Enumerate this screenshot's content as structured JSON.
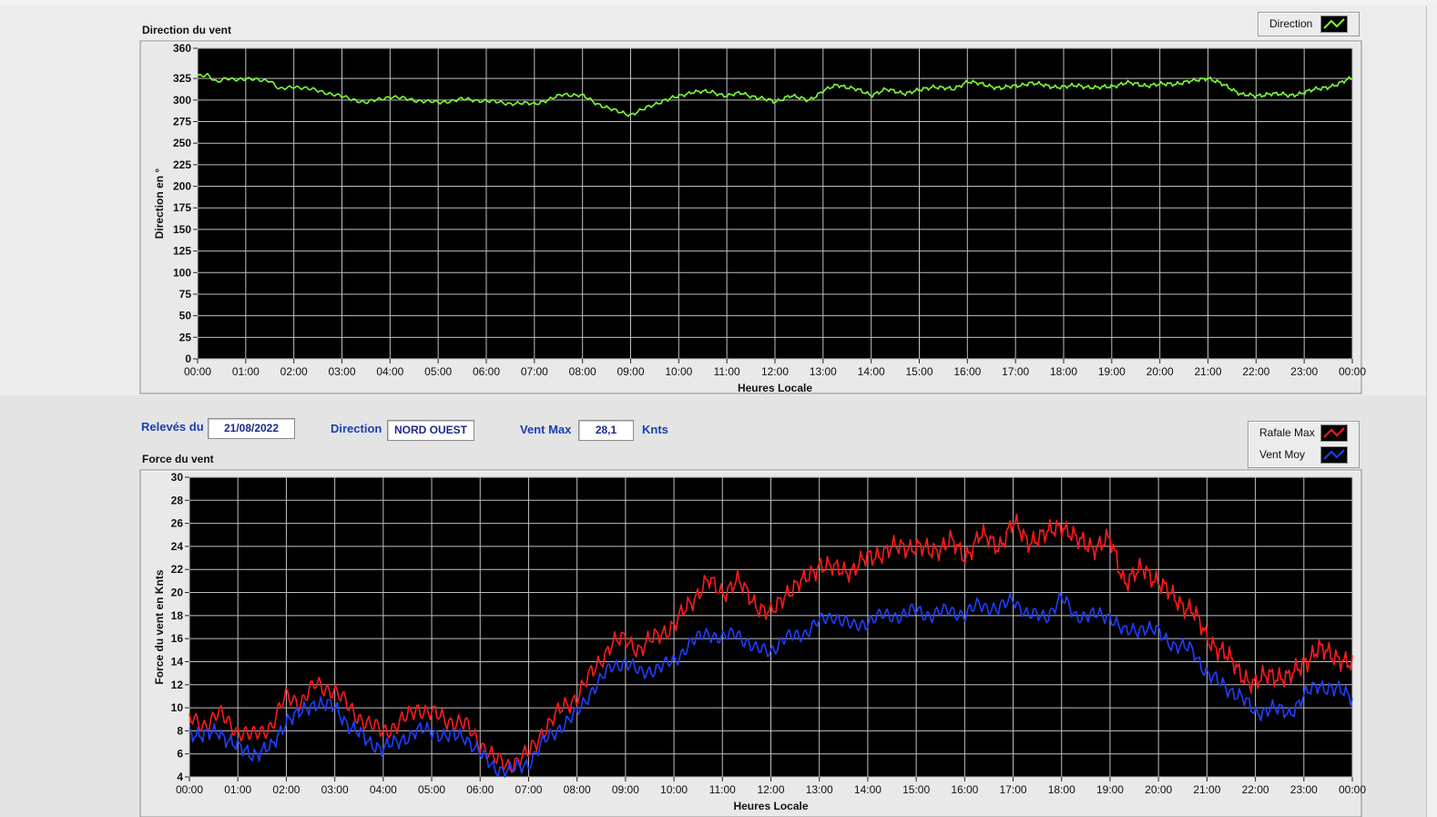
{
  "info": {
    "releves_label": "Relevés du",
    "releves_value": "21/08/2022",
    "direction_label": "Direction",
    "direction_value": "NORD OUEST",
    "ventmax_label": "Vent Max",
    "ventmax_value": "28,1",
    "ventmax_unit": "Knts"
  },
  "colors": {
    "plot_bg": "#000000",
    "grid": "#bfbfbf",
    "direction": "#7CFC3A",
    "rafale": "#ff1a1a",
    "vent_moy": "#1f3fff"
  },
  "chart_data": [
    {
      "type": "line",
      "title": "Direction du vent",
      "xlabel": "Heures Locale",
      "ylabel": "Direction en °",
      "ylim": [
        0,
        360
      ],
      "xlim": [
        0,
        24
      ],
      "yticks": [
        "0",
        "25",
        "50",
        "75",
        "100",
        "125",
        "150",
        "175",
        "200",
        "225",
        "250",
        "275",
        "300",
        "325",
        "360"
      ],
      "xticks": [
        "00:00",
        "01:00",
        "02:00",
        "03:00",
        "04:00",
        "05:00",
        "06:00",
        "07:00",
        "08:00",
        "09:00",
        "10:00",
        "11:00",
        "12:00",
        "13:00",
        "14:00",
        "15:00",
        "16:00",
        "17:00",
        "18:00",
        "19:00",
        "20:00",
        "21:00",
        "22:00",
        "23:00",
        "00:00"
      ],
      "grid": true,
      "legend_position": "top-right",
      "series": [
        {
          "name": "Direction",
          "color": "#7CFC3A",
          "noise": 3,
          "x": [
            0,
            0.2,
            0.4,
            0.6,
            1,
            1.5,
            1.7,
            2,
            2.5,
            3,
            3.5,
            4,
            4.5,
            5,
            5.5,
            6,
            6.5,
            7,
            7.3,
            7.6,
            8,
            8.3,
            8.7,
            9,
            9.3,
            9.7,
            10,
            10.3,
            10.7,
            11,
            11.3,
            11.7,
            12,
            12.3,
            12.7,
            13,
            13.3,
            13.7,
            14,
            14.3,
            14.7,
            15,
            15.3,
            15.7,
            16,
            16.3,
            16.7,
            17,
            17.3,
            17.7,
            18,
            18.3,
            18.7,
            19,
            19.3,
            19.7,
            20,
            20.3,
            20.7,
            21,
            21.3,
            21.7,
            22,
            22.3,
            22.7,
            23,
            23.3,
            23.7,
            24
          ],
          "values": [
            328,
            330,
            320,
            325,
            324,
            323,
            312,
            316,
            311,
            304,
            297,
            304,
            300,
            297,
            301,
            299,
            296,
            296,
            300,
            307,
            305,
            296,
            287,
            283,
            290,
            300,
            304,
            310,
            309,
            305,
            308,
            302,
            298,
            305,
            300,
            310,
            318,
            312,
            306,
            312,
            308,
            311,
            316,
            312,
            322,
            318,
            314,
            316,
            320,
            316,
            315,
            317,
            314,
            316,
            320,
            317,
            318,
            319,
            322,
            326,
            318,
            307,
            304,
            308,
            305,
            309,
            313,
            318,
            326
          ]
        }
      ]
    },
    {
      "type": "line",
      "title": "Force du vent",
      "xlabel": "Heures Locale",
      "ylabel": "Force du vent en Knts",
      "ylim": [
        4,
        30
      ],
      "xlim": [
        0,
        24
      ],
      "yticks": [
        "4",
        "6",
        "8",
        "10",
        "12",
        "14",
        "16",
        "18",
        "20",
        "22",
        "24",
        "26",
        "28",
        "30"
      ],
      "xticks": [
        "00:00",
        "01:00",
        "02:00",
        "03:00",
        "04:00",
        "05:00",
        "06:00",
        "07:00",
        "08:00",
        "09:00",
        "10:00",
        "11:00",
        "12:00",
        "13:00",
        "14:00",
        "15:00",
        "16:00",
        "17:00",
        "18:00",
        "19:00",
        "20:00",
        "21:00",
        "22:00",
        "23:00",
        "00:00"
      ],
      "grid": true,
      "legend_position": "top-right",
      "series": [
        {
          "name": "Rafale Max",
          "color": "#ff1a1a",
          "noise": 1.1,
          "x": [
            0,
            0.3,
            0.6,
            1,
            1.3,
            1.7,
            2,
            2.3,
            2.6,
            3,
            3.3,
            3.7,
            4,
            4.3,
            4.7,
            5,
            5.3,
            5.7,
            6,
            6.3,
            6.6,
            7,
            7.3,
            7.7,
            8,
            8.3,
            8.7,
            9,
            9.3,
            9.7,
            10,
            10.3,
            10.7,
            11,
            11.3,
            11.7,
            12,
            12.3,
            12.7,
            13,
            13.3,
            13.7,
            14,
            14.3,
            14.7,
            15,
            15.3,
            15.7,
            16,
            16.3,
            16.7,
            17,
            17.3,
            17.7,
            18,
            18.3,
            18.7,
            19,
            19.3,
            19.7,
            20,
            20.3,
            20.7,
            21,
            21.3,
            21.7,
            22,
            22.3,
            22.7,
            23,
            23.3,
            23.7,
            24
          ],
          "values": [
            9,
            8.5,
            9.5,
            8,
            7.5,
            8.5,
            11,
            10.5,
            12,
            11.5,
            10,
            8.5,
            8,
            8.5,
            10,
            9.5,
            9,
            8.5,
            7,
            5.5,
            5,
            6,
            8,
            10,
            11,
            13,
            15.5,
            16,
            15,
            16.5,
            17,
            19,
            21,
            20,
            21,
            19,
            18,
            20,
            21,
            22.5,
            22,
            22,
            23,
            23.5,
            24,
            24,
            23.5,
            24.5,
            23,
            25,
            24,
            26,
            24.5,
            25,
            26,
            24.5,
            24,
            24.5,
            21,
            22,
            21,
            19.5,
            18.5,
            16,
            15,
            13,
            12,
            13,
            12.5,
            14,
            15,
            14.5,
            13.5
          ]
        },
        {
          "name": "Vent Moy",
          "color": "#1f3fff",
          "noise": 0.9,
          "x": [
            0,
            0.3,
            0.6,
            1,
            1.3,
            1.7,
            2,
            2.3,
            2.6,
            3,
            3.3,
            3.7,
            4,
            4.3,
            4.7,
            5,
            5.3,
            5.7,
            6,
            6.3,
            6.6,
            7,
            7.3,
            7.7,
            8,
            8.3,
            8.7,
            9,
            9.3,
            9.7,
            10,
            10.3,
            10.7,
            11,
            11.3,
            11.7,
            12,
            12.3,
            12.7,
            13,
            13.3,
            13.7,
            14,
            14.3,
            14.7,
            15,
            15.3,
            15.7,
            16,
            16.3,
            16.7,
            17,
            17.3,
            17.7,
            18,
            18.3,
            18.7,
            19,
            19.3,
            19.7,
            20,
            20.3,
            20.7,
            21,
            21.3,
            21.7,
            22,
            22.3,
            22.7,
            23,
            23.3,
            23.7,
            24
          ],
          "values": [
            8,
            7.5,
            8,
            6.5,
            6,
            6.5,
            9,
            9.5,
            10.5,
            10,
            8.5,
            7,
            6.5,
            7,
            8,
            8,
            7.5,
            7.5,
            6,
            4.8,
            4.5,
            5.2,
            7,
            8.5,
            9.5,
            11.5,
            13.5,
            14,
            13,
            13.5,
            14,
            15.5,
            16.5,
            16,
            16.5,
            15,
            15,
            16,
            16.5,
            17.5,
            18,
            17,
            17.5,
            18,
            18,
            18.5,
            18,
            18.5,
            18,
            19,
            18.5,
            19.5,
            18,
            18,
            19.5,
            18,
            18,
            18,
            16.5,
            17,
            16.5,
            15.5,
            15,
            13,
            12,
            11,
            9.5,
            10,
            9.5,
            11,
            12,
            11.5,
            11
          ]
        }
      ]
    }
  ]
}
